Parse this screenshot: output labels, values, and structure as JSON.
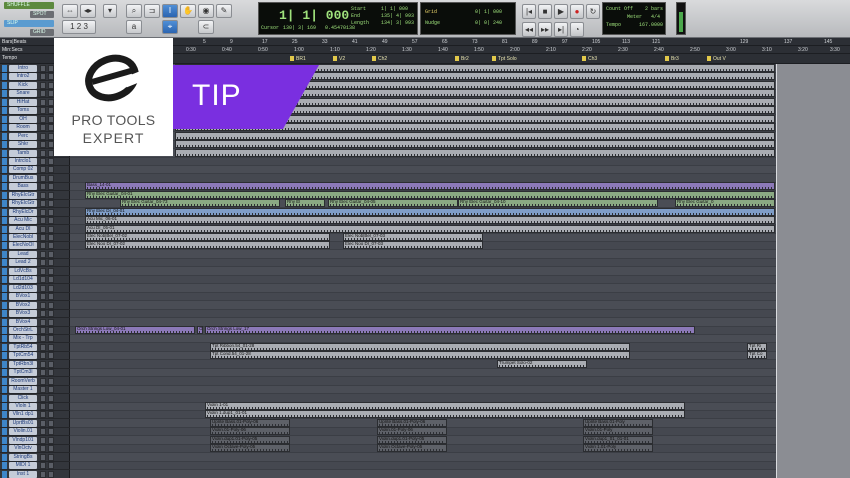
{
  "toolbar": {
    "modes": [
      "SHUFFLE",
      "SPOT",
      "SLIP",
      "GRID"
    ],
    "main_counter": "1| 1| 000",
    "cursor_label": "Cursor",
    "cursor_value": "130| 3| 169",
    "cursor_sample": "0.45470138",
    "start_label": "Start",
    "start_value": "1| 1| 000",
    "end_label": "End",
    "end_value": "135| 4| 993",
    "length_label": "Length",
    "length_value": "134| 3| 993",
    "grid_label": "Grid",
    "grid_value": "0| 1| 000",
    "nudge_label": "Nudge",
    "nudge_value": "0| 0| 240",
    "countoff_label": "Count Off",
    "countoff_value": "2 bars",
    "meter_label": "Meter",
    "meter_value": "4/4",
    "tempo_label": "Tempo",
    "tempo_value": "167.0000"
  },
  "rulers": {
    "names": [
      "Bars|Beats",
      "Min:Secs",
      "Tempo"
    ],
    "bars": [
      "5",
      "9",
      "17",
      "25",
      "33",
      "41",
      "49",
      "57",
      "65",
      "73",
      "81",
      "89",
      "97",
      "105",
      "113",
      "121",
      "129",
      "137",
      "145"
    ],
    "secs": [
      "0:10",
      "0:20",
      "0:30",
      "0:40",
      "0:50",
      "1:00",
      "1:10",
      "1:20",
      "1:30",
      "1:40",
      "1:50",
      "2:00",
      "2:10",
      "2:20",
      "2:30",
      "2:40",
      "2:50",
      "3:00",
      "3:10",
      "3:20",
      "3:30"
    ],
    "markers": [
      "BR1",
      "V2",
      "Ch2",
      "Br2",
      "Tpt Solo",
      "Ch3",
      "Br3",
      "Out V"
    ]
  },
  "tracks": [
    "Intro",
    "Intro2",
    "Kick",
    "Snare",
    "HiHat",
    "Toms",
    "OH",
    "Room",
    "Perc",
    "Shkr",
    "Tamb",
    "Intrclo1",
    "Comp 02",
    "DrumBus",
    "Bass",
    "RhyElcGtr",
    "RhyElcGtr",
    "RhyElcDr",
    "Acu Mic",
    "Acu DI",
    "ElecNobl",
    "ElecNoOl",
    "Lead",
    "Lead 2",
    "LdVcBs",
    "Ld1d104",
    "Ld2d103",
    "BVox1",
    "BVox2",
    "BVox3",
    "BVox4",
    "OrchStrL",
    "Mix - Trp",
    "TptRb54",
    "TptCm54",
    "TptRbn3l",
    "TptCm3l",
    "RoomVerb",
    "Master 1",
    "Click",
    "Vloln 1",
    "Vlln1 dp1",
    "UprtBs01",
    "Violin.01",
    "Vlndp101",
    "VlnOctv",
    "StringBs",
    "MIDI 1",
    "Inst 1"
  ],
  "clips": {
    "bass": "Bass_14-01",
    "rhy1": "Rhy Elec Guitar_04-01",
    "rhy2": "Rhy Elec Guitar_04-73",
    "rhy3": "Rhy El",
    "rhy4": "Rhy Elec Guitar_04-05",
    "rhy5": "Rhy Elec Guitar_04-10",
    "rhy6": "Rhy Elec Guitar_0",
    "rhydi": "Rhy Elec DI_04-01",
    "acumic": "Acu Mic_06-01",
    "acudi": "Acu DI_05-01",
    "elecnob1": "Elec Nob|Bel_07-02",
    "elecnob2": "Elec Nob|Bel_07-03",
    "elecnoo1": "Elec Noo DI_07-02",
    "elecnoo2": "Elec Noo DI_07-03",
    "orch1": "Orch Strings Low_04-01",
    "orch2": "Or",
    "orch3": "Orch Strings Low_17",
    "tptrb": "Tpt Ribbon.54_01-28",
    "tptcm": "Tpt Cond.54_01-28",
    "tptsolo": "Trumpet Solo-02",
    "tptr2": "Tpt Ri",
    "tptc2": "Tpt Co",
    "vln1": "Violin 1-01",
    "vln1d": "Violin 1.dup1_01-01",
    "upb1": "Uprite Bass.01-Poly-06",
    "upb2": "Uprite Bass.01-Poly-06",
    "upb3": "Uprite Bass.01-Poly",
    "v01": "Violin.01-Poly-06",
    "v02": "Violin.01-Poly-06",
    "v03": "Violin.01-Poly",
    "vd1": "Violin.dup1.01-Poly-05",
    "vd2": "Violin.dup1.01-Poly-05",
    "vd3": "Violin.dup1_01_01-01",
    "vo1": "Violin Octave-Poly-05",
    "vo2": "Violin Octave-Poly-05",
    "vo3": "Violin 1.01-Poly"
  },
  "overlay": {
    "brand_line1": "PRO TOOLS",
    "brand_line2": "EXPERT",
    "tip": "TIP",
    "accent_color": "#7a2fe0"
  }
}
